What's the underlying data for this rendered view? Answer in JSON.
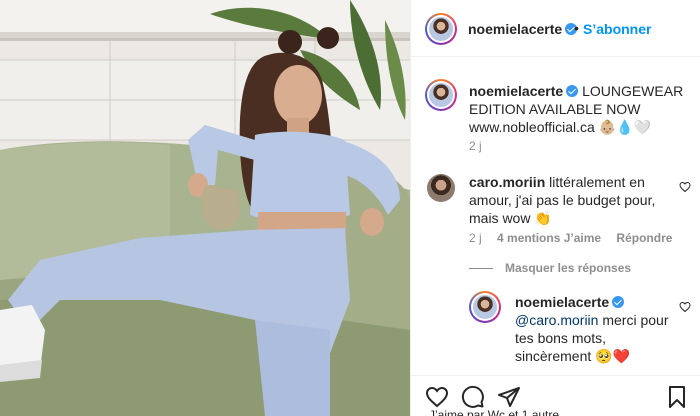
{
  "post": {
    "author": "noemielacerte",
    "follow_label": "S’abonner",
    "separator": "•"
  },
  "caption": {
    "username": "noemielacerte",
    "text_line1": "LOUNGEWEAR",
    "text_line2": "EDITION AVAILABLE NOW",
    "text_line3": "www.nobleofficial.ca 👶🏼💧🤍",
    "time": "2 j"
  },
  "comment": {
    "username": "caro.moriin",
    "line1": "littéralement en",
    "line2": "amour, j'ai pas le budget pour,",
    "line3": "mais wow 👏",
    "time": "2 j",
    "likes": "4 mentions J’aime",
    "reply_label": "Répondre",
    "hide_replies_label": "Masquer les réponses"
  },
  "reply": {
    "username": "noemielacerte",
    "mention": "@caro.moriin",
    "line1_rest": "merci pour",
    "line2": "tes bons mots,",
    "line3": "sincèrement 🥺❤️"
  },
  "actions": {
    "icons": [
      "heart-icon",
      "comment-icon",
      "share-icon",
      "bookmark-icon"
    ],
    "likes_partial": "J’aime par Wc et 1 autre…"
  },
  "colors": {
    "accent": "#0095f6",
    "verified": "#3897f0",
    "muted": "#8e8e8e",
    "text": "#262626",
    "mention": "#00376b"
  }
}
